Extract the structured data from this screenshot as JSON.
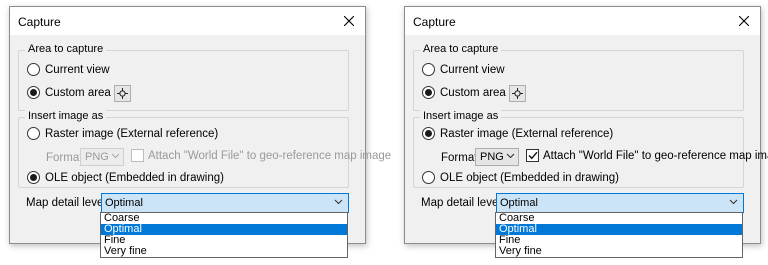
{
  "dialogs": [
    {
      "title": "Capture",
      "area_group": {
        "legend": "Area to capture",
        "current_view": "Current view",
        "custom_area": "Custom area",
        "selected": "custom_area"
      },
      "insert_group": {
        "legend": "Insert image as",
        "raster": "Raster image (External reference)",
        "format_label": "Format",
        "format_value": "PNG",
        "world_file_label": "Attach \"World File\" to geo-reference map image",
        "world_file_checked": false,
        "ole": "OLE object (Embedded in drawing)",
        "selected": "ole"
      },
      "map_detail": {
        "label": "Map detail level",
        "value": "Optimal",
        "options": [
          "Coarse",
          "Optimal",
          "Fine",
          "Very fine"
        ],
        "highlighted": "Optimal"
      }
    },
    {
      "title": "Capture",
      "area_group": {
        "legend": "Area to capture",
        "current_view": "Current view",
        "custom_area": "Custom area",
        "selected": "custom_area"
      },
      "insert_group": {
        "legend": "Insert image as",
        "raster": "Raster image (External reference)",
        "format_label": "Format",
        "format_value": "PNG",
        "world_file_label": "Attach \"World File\" to geo-reference map image",
        "world_file_checked": true,
        "ole": "OLE object (Embedded in drawing)",
        "selected": "raster"
      },
      "map_detail": {
        "label": "Map detail level",
        "value": "Optimal",
        "options": [
          "Coarse",
          "Optimal",
          "Fine",
          "Very fine"
        ],
        "highlighted": "Optimal"
      }
    }
  ],
  "icons": {
    "close": "close-icon",
    "pick": "crosshair-icon",
    "chevron": "chevron-down-icon",
    "check": "checkmark-icon"
  },
  "colors": {
    "dialog_bg": "#f0f0f0",
    "accent": "#0078d7",
    "select_highlight": "#cce4f7"
  }
}
